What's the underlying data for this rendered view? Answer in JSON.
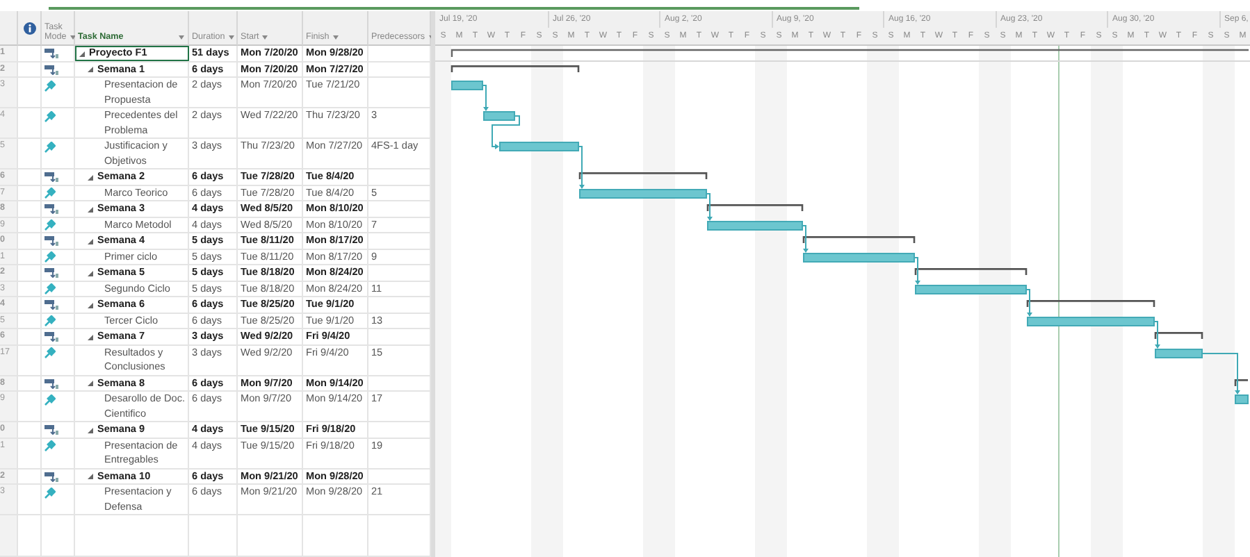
{
  "columns": [
    {
      "kind": "indicator"
    },
    {
      "kind": "mode",
      "label": "Task Mode",
      "selected": false
    },
    {
      "kind": "name",
      "label": "Task Name",
      "selected": true
    },
    {
      "kind": "duration",
      "label": "Duration",
      "selected": false
    },
    {
      "kind": "start",
      "label": "Start",
      "selected": false
    },
    {
      "kind": "finish",
      "label": "Finish",
      "selected": false
    },
    {
      "kind": "pred",
      "label": "Predecessors",
      "selected": false
    }
  ],
  "timescale": {
    "weeks": [
      "Jul 19, '20",
      "Jul 26, '20",
      "Aug 2, '20",
      "Aug 9, '20",
      "Aug 16, '20",
      "Aug 23, '20",
      "Aug 30, '20",
      "Sep 6,"
    ],
    "days": [
      "S",
      "M",
      "T",
      "W",
      "T",
      "F",
      "S",
      "S",
      "M",
      "T",
      "W",
      "T",
      "F",
      "S",
      "S",
      "M",
      "T",
      "W",
      "T",
      "F",
      "S",
      "S",
      "M",
      "T",
      "W",
      "T",
      "F",
      "S",
      "S",
      "M",
      "T",
      "W",
      "T",
      "F",
      "S",
      "S",
      "M",
      "T",
      "W",
      "T",
      "F",
      "S",
      "S",
      "M",
      "T",
      "W",
      "T",
      "F",
      "S",
      "S",
      "M"
    ]
  },
  "tasks": [
    {
      "id": "1",
      "kind": "project",
      "name": "Proyecto F1",
      "duration": "51 days",
      "start": "Mon 7/20/20",
      "finish": "Mon 9/28/20",
      "expanded": true,
      "selected": true,
      "children": [
        {
          "id": "2",
          "kind": "summary",
          "name": "Semana 1",
          "duration": "6 days",
          "start": "Mon 7/20/20",
          "finish": "Mon 7/27/20",
          "expanded": true,
          "selected": false,
          "children": [
            {
              "id": "3",
              "kind": "task",
              "name": "Presentacion de Propuesta",
              "duration": "2 days",
              "start": "Mon 7/20/20",
              "finish": "Tue 7/21/20",
              "selected": false
            },
            {
              "id": "4",
              "kind": "task",
              "name": "Precedentes del Problema",
              "duration": "2 days",
              "start": "Wed 7/22/20",
              "finish": "Thu 7/23/20",
              "predecessors": "3",
              "selected": false
            },
            {
              "id": "5",
              "kind": "task",
              "name": "Justificacion y Objetivos",
              "duration": "3 days",
              "start": "Thu 7/23/20",
              "finish": "Mon 7/27/20",
              "predecessors": "4FS-1 day",
              "selected": false
            }
          ]
        },
        {
          "id": "6",
          "kind": "summary",
          "name": "Semana 2",
          "duration": "6 days",
          "start": "Tue 7/28/20",
          "finish": "Tue 8/4/20",
          "expanded": true,
          "selected": false,
          "children": [
            {
              "id": "7",
              "kind": "task",
              "name": "Marco Teorico",
              "duration": "6 days",
              "start": "Tue 7/28/20",
              "finish": "Tue 8/4/20",
              "predecessors": "5",
              "selected": false
            }
          ]
        },
        {
          "id": "8",
          "kind": "summary",
          "name": "Semana 3",
          "duration": "4 days",
          "start": "Wed 8/5/20",
          "finish": "Mon 8/10/20",
          "expanded": true,
          "selected": false,
          "children": [
            {
              "id": "9",
              "kind": "task",
              "name": "Marco Metodol",
              "duration": "4 days",
              "start": "Wed 8/5/20",
              "finish": "Mon 8/10/20",
              "predecessors": "7",
              "selected": false
            }
          ]
        },
        {
          "id": "0",
          "kind": "summary",
          "name": "Semana 4",
          "duration": "5 days",
          "start": "Tue 8/11/20",
          "finish": "Mon 8/17/20",
          "expanded": true,
          "selected": false,
          "children": [
            {
              "id": "1",
              "kind": "task",
              "name": "Primer ciclo",
              "duration": "5 days",
              "start": "Tue 8/11/20",
              "finish": "Mon 8/17/20",
              "predecessors": "9",
              "selected": false
            }
          ]
        },
        {
          "id": "2",
          "kind": "summary",
          "name": "Semana 5",
          "duration": "5 days",
          "start": "Tue 8/18/20",
          "finish": "Mon 8/24/20",
          "expanded": true,
          "selected": false,
          "children": [
            {
              "id": "3",
              "kind": "task",
              "name": "Segundo Ciclo",
              "duration": "5 days",
              "start": "Tue 8/18/20",
              "finish": "Mon 8/24/20",
              "predecessors": "11",
              "selected": false
            }
          ]
        },
        {
          "id": "4",
          "kind": "summary",
          "name": "Semana 6",
          "duration": "6 days",
          "start": "Tue 8/25/20",
          "finish": "Tue 9/1/20",
          "expanded": true,
          "selected": false,
          "children": [
            {
              "id": "5",
              "kind": "task",
              "name": "Tercer Ciclo",
              "duration": "6 days",
              "start": "Tue 8/25/20",
              "finish": "Tue 9/1/20",
              "predecessors": "13",
              "selected": false
            }
          ]
        },
        {
          "id": "6",
          "kind": "summary",
          "name": "Semana 7",
          "duration": "3 days",
          "start": "Wed 9/2/20",
          "finish": "Fri 9/4/20",
          "expanded": true,
          "selected": false,
          "children": [
            {
              "id": "17",
              "kind": "task",
              "name": "Resultados y Conclusiones",
              "duration": "3 days",
              "start": "Wed 9/2/20",
              "finish": "Fri 9/4/20",
              "predecessors": "15",
              "selected": false
            }
          ]
        },
        {
          "id": "8",
          "kind": "summary",
          "name": "Semana 8",
          "duration": "6 days",
          "start": "Mon 9/7/20",
          "finish": "Mon 9/14/20",
          "expanded": true,
          "selected": false,
          "children": [
            {
              "id": "9",
              "kind": "task",
              "name": "Desarollo de Doc. Cientifico",
              "duration": "6 days",
              "start": "Mon 9/7/20",
              "finish": "Mon 9/14/20",
              "predecessors": "17",
              "selected": false
            }
          ]
        },
        {
          "id": "0",
          "kind": "summary",
          "name": "Semana 9",
          "duration": "4 days",
          "start": "Tue 9/15/20",
          "finish": "Fri 9/18/20",
          "expanded": true,
          "selected": false,
          "children": [
            {
              "id": "1",
              "kind": "task",
              "name": "Presentacion de Entregables",
              "duration": "4 days",
              "start": "Tue 9/15/20",
              "finish": "Fri 9/18/20",
              "predecessors": "19",
              "selected": false
            }
          ]
        },
        {
          "id": "2",
          "kind": "summary",
          "name": "Semana 10",
          "duration": "6 days",
          "start": "Mon 9/21/20",
          "finish": "Mon 9/28/20",
          "expanded": true,
          "selected": false,
          "children": [
            {
              "id": "3",
              "kind": "task",
              "name": "Presentacion y Defensa",
              "duration": "6 days",
              "start": "Mon 9/21/20",
              "finish": "Mon 9/28/20",
              "predecessors": "21",
              "selected": false
            }
          ]
        }
      ]
    }
  ]
}
